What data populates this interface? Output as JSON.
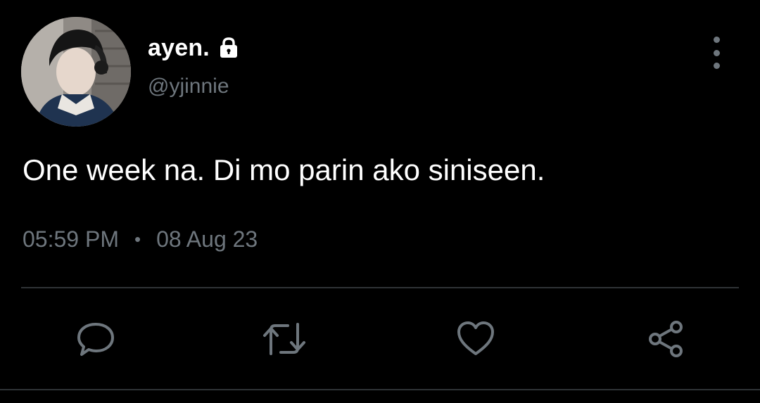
{
  "tweet": {
    "display_name": "ayen.",
    "handle": "@yjinnie",
    "text": "One week na. Di mo parin ako siniseen.",
    "time": "05:59 PM",
    "separator": "•",
    "date": "08 Aug 23",
    "protected": true
  },
  "icons": {
    "lock": "lock-icon",
    "more": "more-vertical-icon",
    "reply": "reply-icon",
    "retweet": "retweet-icon",
    "like": "heart-icon",
    "share": "share-icon"
  },
  "colors": {
    "background": "#000000",
    "text_primary": "#ffffff",
    "text_secondary": "#6e767d",
    "divider": "#2f3336"
  }
}
